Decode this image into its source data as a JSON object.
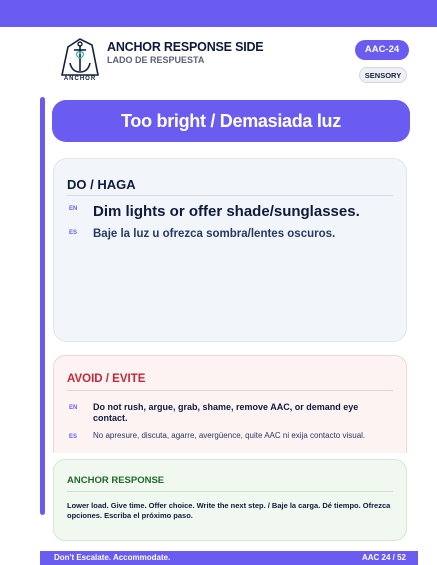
{
  "header": {
    "logo_text": "ANCHOR",
    "title": "ANCHOR RESPONSE SIDE",
    "subtitle": "LADO DE RESPUESTA",
    "card_id": "AAC-24",
    "category": "SENSORY"
  },
  "situation": "Too bright / Demasiada luz",
  "do_section": {
    "heading": "DO / HAGA",
    "en_tag": "EN",
    "en_text": "Dim lights or offer shade/sunglasses.",
    "es_tag": "ES",
    "es_text": "Baje la luz u ofrezca sombra/lentes oscuros."
  },
  "avoid_section": {
    "heading": "AVOID / EVITE",
    "en_tag": "EN",
    "en_text": "Do not rush, argue, grab, shame, remove AAC, or demand eye contact.",
    "es_tag": "ES",
    "es_text": "No apresure, discuta, agarre, avergüence, quite AAC ni exija contacto visual."
  },
  "response_section": {
    "heading": "ANCHOR RESPONSE",
    "text": "Lower load. Give time. Offer choice. Write the next step. / Baje la carga. Dé tiempo. Ofrezca opciones. Escriba el próximo paso."
  },
  "footer": {
    "tagline": "Don't Escalate. Accommodate.",
    "page": "AAC 24 / 52"
  },
  "colors": {
    "brand": "#6a5cf0",
    "avoid": "#c4283a",
    "response": "#1f6a2c"
  }
}
